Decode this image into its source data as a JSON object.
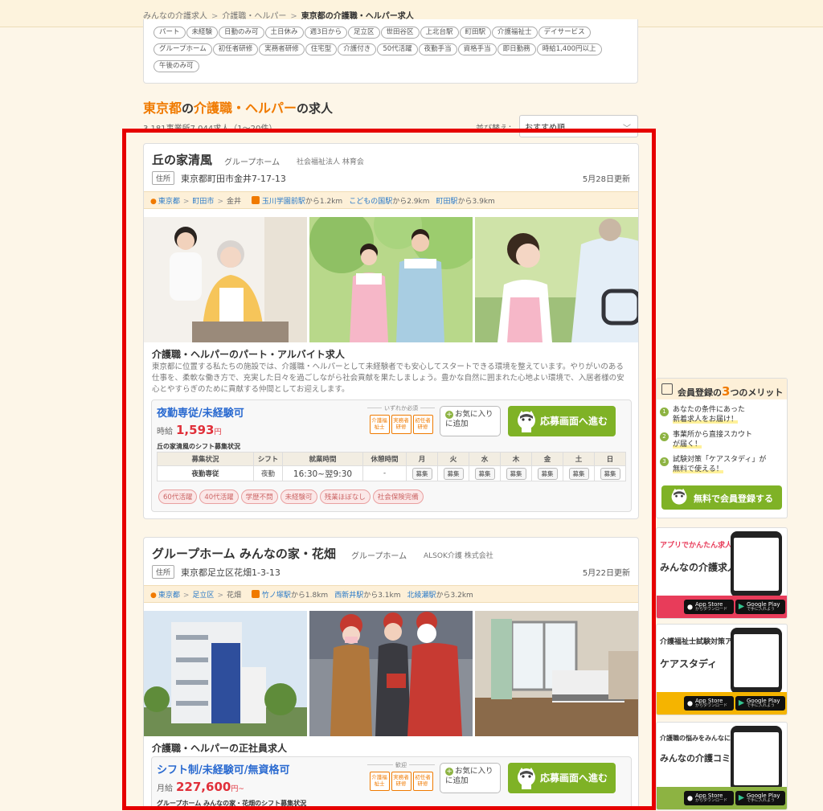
{
  "breadcrumb": [
    "みんなの介護求人",
    "介護職・ヘルパー",
    "東京都の介護職・ヘルパー求人"
  ],
  "tags": [
    "パート",
    "未経験",
    "日勤のみ可",
    "土日休み",
    "週3日から",
    "足立区",
    "世田谷区",
    "上北台駅",
    "町田駅",
    "介護福祉士",
    "デイサービス",
    "グループホーム",
    "初任者研修",
    "実務者研修",
    "住宅型",
    "介護付き",
    "50代活躍",
    "夜勤手当",
    "資格手当",
    "即日勤務",
    "時給1,400円以上",
    "午後のみ可"
  ],
  "result": {
    "title_pref": "東京都",
    "title_mid": "の",
    "title_job": "介護職・ヘルパー",
    "title_tail": "の求人",
    "count": "3,181事業所7,044求人（1〜20件）",
    "sort_label": "並び替え：",
    "sort_value": "おすすめ順"
  },
  "cards": [
    {
      "name": "丘の家清風",
      "type": "グループホーム",
      "corp": "社会福祉法人 林育会",
      "addr_tag": "住所",
      "address": "東京都町田市金井7-17-13",
      "updated": "5月28日更新",
      "loc": [
        "東京都",
        "町田市",
        "金井"
      ],
      "stations": [
        {
          "name": "玉川学園前駅",
          "dist": "から1.2km"
        },
        {
          "name": "こどもの国駅",
          "dist": "から2.9km"
        },
        {
          "name": "町田駅",
          "dist": "から3.9km"
        }
      ],
      "job_title": "介護職・ヘルパーのパート・アルバイト求人",
      "desc": "東京都に位置する私たちの施設では、介護職・ヘルパーとして未経験者でも安心してスタートできる環境を整えています。やりがいのある仕事を、柔軟な働き方で、充実した日々を過ごしながら社会貢献を果たしましょう。豊かな自然に囲まれた心地よい環境で、入居者様の安心とやすらぎのために貢献する仲間としてお迎えします。",
      "jobbox_title": "夜勤専従/未経験可",
      "wage_type": "時給",
      "wage": "1,593",
      "wage_unit": "円",
      "qual_label": "いずれか必須",
      "badges": [
        "介護福祉士",
        "実務者研修",
        "初任者研修"
      ],
      "fav": "お気に入りに追加",
      "apply": "応募画面へ進む",
      "shift_label": "丘の家清風のシフト募集状況",
      "shift_head": [
        "募集状況",
        "シフト",
        "就業時間",
        "休憩時間",
        "月",
        "火",
        "水",
        "木",
        "金",
        "土",
        "日"
      ],
      "shift_row": {
        "status": "夜勤専従",
        "shift": "夜勤",
        "time": "16:30~翌9:30",
        "rest": "-",
        "days": [
          "募集",
          "募集",
          "募集",
          "募集",
          "募集",
          "募集",
          "募集"
        ]
      },
      "features": [
        "60代活躍",
        "40代活躍",
        "学歴不問",
        "未経験可",
        "残業ほぼなし",
        "社会保険完備"
      ]
    },
    {
      "name": "グループホーム みんなの家・花畑",
      "type": "グループホーム",
      "corp": "ALSOK介護 株式会社",
      "addr_tag": "住所",
      "address": "東京都足立区花畑1-3-13",
      "updated": "5月22日更新",
      "loc": [
        "東京都",
        "足立区",
        "花畑"
      ],
      "stations": [
        {
          "name": "竹ノ塚駅",
          "dist": "から1.8km"
        },
        {
          "name": "西新井駅",
          "dist": "から3.1km"
        },
        {
          "name": "北綾瀬駅",
          "dist": "から3.2km"
        }
      ],
      "job_title": "介護職・ヘルパーの正社員求人",
      "jobbox_title": "シフト制/未経験可/無資格可",
      "wage_type": "月給",
      "wage": "227,600",
      "wage_unit": "円~",
      "qual_label": "歓迎",
      "badges": [
        "介護福祉士",
        "実務者研修",
        "初任者研修"
      ],
      "fav": "お気に入りに追加",
      "apply": "応募画面へ進む",
      "shift_label": "グループホーム みんなの家・花畑のシフト募集状況"
    }
  ],
  "merit": {
    "head_pre": "会員登録の",
    "head_num": "3",
    "head_post": "つのメリット",
    "items": [
      {
        "n": "1",
        "a": "あなたの条件にあった",
        "b": "新着求人をお届け！"
      },
      {
        "n": "2",
        "a": "事業所から直接スカウト",
        "b": "が届く！"
      },
      {
        "n": "3",
        "a": "試験対策「ケアスタディ」が",
        "b": "無料で使える！"
      }
    ],
    "button": "無料で会員登録する"
  },
  "ads": [
    {
      "line1": "アプリでかんたん求人検索!",
      "line2": "みんなの介護求人",
      "color": "#e83c5a"
    },
    {
      "line1": "介護福祉士試験対策アプリ",
      "line2": "ケアスタディ",
      "color": "#f07a00"
    },
    {
      "line1": "介護職の悩みをみんなに相談出来る!",
      "line2": "みんなの介護コミュニティ",
      "color": "#f07a00"
    }
  ],
  "stores": {
    "apple": "App Store",
    "apple_sub": "からダウンロード",
    "google": "Google Play",
    "google_sub": "で手に入れよう"
  }
}
